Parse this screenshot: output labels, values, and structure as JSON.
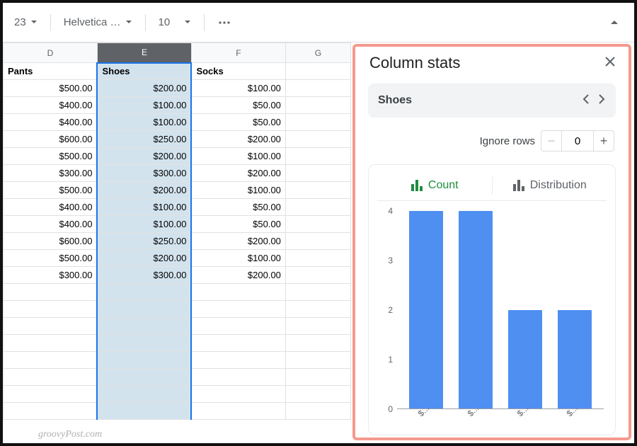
{
  "toolbar": {
    "format_code": "23",
    "font_name": "Helvetica …",
    "font_size": "10"
  },
  "sheet": {
    "col_headers": [
      "D",
      "E",
      "F",
      "G"
    ],
    "selected_col_index": 1,
    "row_headers": [
      "Pants",
      "Shoes",
      "Socks"
    ],
    "rows": [
      {
        "D": "$500.00",
        "E": "$200.00",
        "F": "$100.00"
      },
      {
        "D": "$400.00",
        "E": "$100.00",
        "F": "$50.00"
      },
      {
        "D": "$400.00",
        "E": "$100.00",
        "F": "$50.00"
      },
      {
        "D": "$600.00",
        "E": "$250.00",
        "F": "$200.00"
      },
      {
        "D": "$500.00",
        "E": "$200.00",
        "F": "$100.00"
      },
      {
        "D": "$300.00",
        "E": "$300.00",
        "F": "$200.00"
      },
      {
        "D": "$500.00",
        "E": "$200.00",
        "F": "$100.00"
      },
      {
        "D": "$400.00",
        "E": "$100.00",
        "F": "$50.00"
      },
      {
        "D": "$400.00",
        "E": "$100.00",
        "F": "$50.00"
      },
      {
        "D": "$600.00",
        "E": "$250.00",
        "F": "$200.00"
      },
      {
        "D": "$500.00",
        "E": "$200.00",
        "F": "$100.00"
      },
      {
        "D": "$300.00",
        "E": "$300.00",
        "F": "$200.00"
      }
    ],
    "watermark": "groovyPost.com"
  },
  "panel": {
    "title": "Column stats",
    "column_name": "Shoes",
    "ignore_rows_label": "Ignore rows",
    "ignore_rows_value": "0",
    "tabs": {
      "count": "Count",
      "distribution": "Distribution",
      "active": "count"
    }
  },
  "chart_data": {
    "type": "bar",
    "categories": [
      "$...",
      "$...",
      "$...",
      "$..."
    ],
    "values": [
      4,
      4,
      2,
      2
    ],
    "ylim": [
      0,
      4
    ],
    "yticks": [
      0,
      1,
      2,
      3,
      4
    ],
    "xlabel": "",
    "ylabel": "",
    "title": ""
  }
}
